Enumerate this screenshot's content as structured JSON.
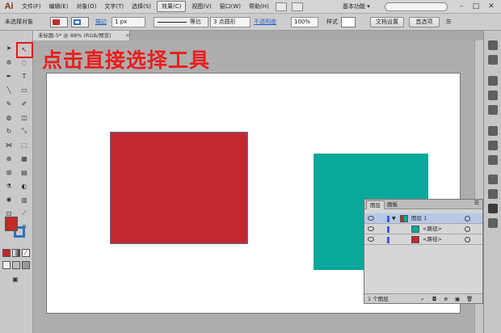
{
  "menubar": {
    "logo": "Ai",
    "items": [
      "文件(F)",
      "编辑(E)",
      "对象(O)",
      "文字(T)",
      "选择(S)",
      "效果(C)",
      "视图(V)",
      "窗口(W)",
      "帮助(H)"
    ],
    "workspace": "基本功能 ▾",
    "search_placeholder": "",
    "window_minimize": "–",
    "window_maximize": "□",
    "window_close": "✕"
  },
  "control_bar": {
    "selection_label": "未选择对象",
    "stroke_label": "描边",
    "stroke_weight": "1 px",
    "brush_label": "等比",
    "brush_points": "3 点圆形",
    "opacity_label": "不透明度",
    "opacity_value": "100%",
    "style_label": "样式",
    "doc_setup_button": "文档设置",
    "preferences_button": "首选项",
    "fill_color": "#c42828",
    "stroke_color": "#2a73c4"
  },
  "document": {
    "tab_title": "未标题-5* @ 88% (RGB/预览)",
    "tab_close": "×"
  },
  "annotation": {
    "text": "点击直接选择工具",
    "color": "#ea1d1d"
  },
  "artwork": {
    "red_rect_color": "#c2282f",
    "teal_rect_color": "#0aa89a"
  },
  "layers_panel": {
    "tab_layers": "图层",
    "tab_artboards": "画板",
    "layer_name": "图层 1",
    "path_1": "<路径>",
    "path_2": "<路径>",
    "footer": "1 个图层",
    "path_1_color": "#0aa89a",
    "path_2_color": "#c2282f"
  }
}
